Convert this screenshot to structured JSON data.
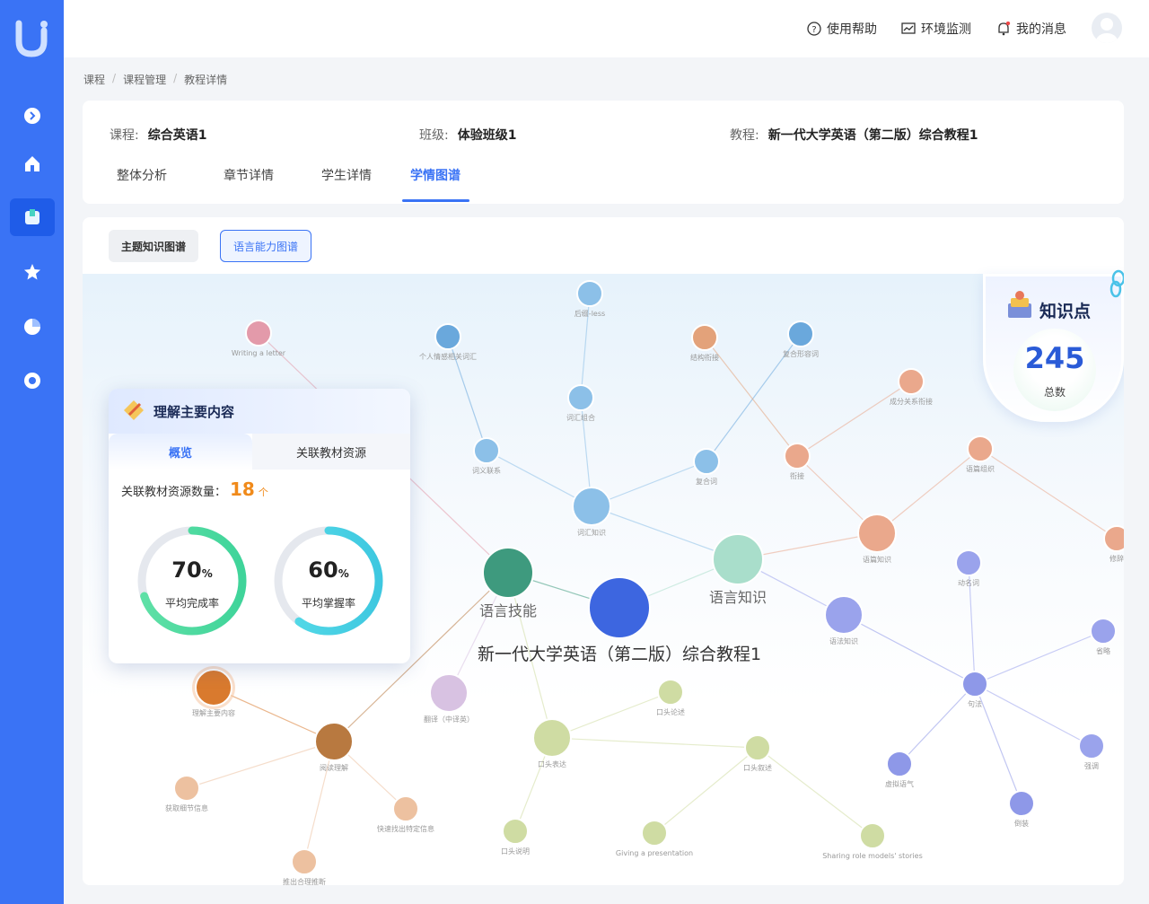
{
  "topbar": {
    "help": "使用帮助",
    "monitor": "环境监测",
    "messages": "我的消息"
  },
  "breadcrumb": [
    "课程",
    "课程管理",
    "教程详情"
  ],
  "info": {
    "course_label": "课程:",
    "course_value": "综合英语1",
    "class_label": "班级:",
    "class_value": "体验班级1",
    "textbook_label": "教程:",
    "textbook_value": "新一代大学英语（第二版）综合教程1"
  },
  "tabs": [
    "整体分析",
    "章节详情",
    "学生详情",
    "学情图谱"
  ],
  "graph_buttons": {
    "topic": "主题知识图谱",
    "language": "语言能力图谱"
  },
  "knowledge_card": {
    "title": "知识点",
    "total": "245",
    "total_label": "总数"
  },
  "popup": {
    "title": "理解主要内容",
    "tab_overview": "概览",
    "tab_resources": "关联教材资源",
    "resource_label": "关联教材资源数量：",
    "resource_count": "18",
    "resource_unit": "个",
    "completion": {
      "value": 70,
      "pct": "70",
      "suffix": "%",
      "label": "平均完成率"
    },
    "mastery": {
      "value": 60,
      "pct": "60",
      "suffix": "%",
      "label": "平均掌握率"
    }
  },
  "graph": {
    "nodes": [
      {
        "label": "新一代大学英语（第二版）综合教程1",
        "color": "#3d66e0",
        "group": "root"
      },
      {
        "label": "语言技能",
        "color": "#3e9a7e",
        "group": "hub"
      },
      {
        "label": "语言知识",
        "color": "#a9decb",
        "group": "hub"
      },
      {
        "label": "词汇知识",
        "color": "#8cc0e8"
      },
      {
        "label": "词义联系",
        "color": "#8cc0e8"
      },
      {
        "label": "个人情感相关词汇",
        "color": "#6aa8dc"
      },
      {
        "label": "词汇组合",
        "color": "#8cc0e8"
      },
      {
        "label": "后缀-less",
        "color": "#8cc0e8"
      },
      {
        "label": "复合词",
        "color": "#8cc0e8"
      },
      {
        "label": "复合形容词",
        "color": "#6aa8dc"
      },
      {
        "label": "结构衔接",
        "color": "#e3a27a"
      },
      {
        "label": "衔接",
        "color": "#eaa88c"
      },
      {
        "label": "成分关系衔接",
        "color": "#eaa88c"
      },
      {
        "label": "语篇知识",
        "color": "#eaa88c"
      },
      {
        "label": "语篇组织",
        "color": "#eaa88c"
      },
      {
        "label": "修辞",
        "color": "#eaa88c"
      },
      {
        "label": "语法知识",
        "color": "#9aa3ec"
      },
      {
        "label": "动名词",
        "color": "#9aa3ec"
      },
      {
        "label": "句法",
        "color": "#8e98e8"
      },
      {
        "label": "省略",
        "color": "#9aa3ec"
      },
      {
        "label": "强调",
        "color": "#9aa3ec"
      },
      {
        "label": "虚拟语气",
        "color": "#8e98e8"
      },
      {
        "label": "倒装",
        "color": "#8e98e8"
      },
      {
        "label": "Writing a letter",
        "color": "#e39aaa"
      },
      {
        "label": "理解主要内容",
        "color": "#d97a2e"
      },
      {
        "label": "阅读理解",
        "color": "#b87940"
      },
      {
        "label": "获取细节信息",
        "color": "#edc1a0"
      },
      {
        "label": "快速找出特定信息",
        "color": "#edc1a0"
      },
      {
        "label": "推出合理推断",
        "color": "#edc1a0"
      },
      {
        "label": "翻译（中译英）",
        "color": "#d8c2e2"
      },
      {
        "label": "口头表达",
        "color": "#cfdca3"
      },
      {
        "label": "口头论述",
        "color": "#cfdca3"
      },
      {
        "label": "口头叙述",
        "color": "#cfdca3"
      },
      {
        "label": "口头说明",
        "color": "#cfdca3"
      },
      {
        "label": "Giving a presentation",
        "color": "#cfdca3"
      },
      {
        "label": "Sharing role models' stories",
        "color": "#cfdca3"
      }
    ]
  }
}
